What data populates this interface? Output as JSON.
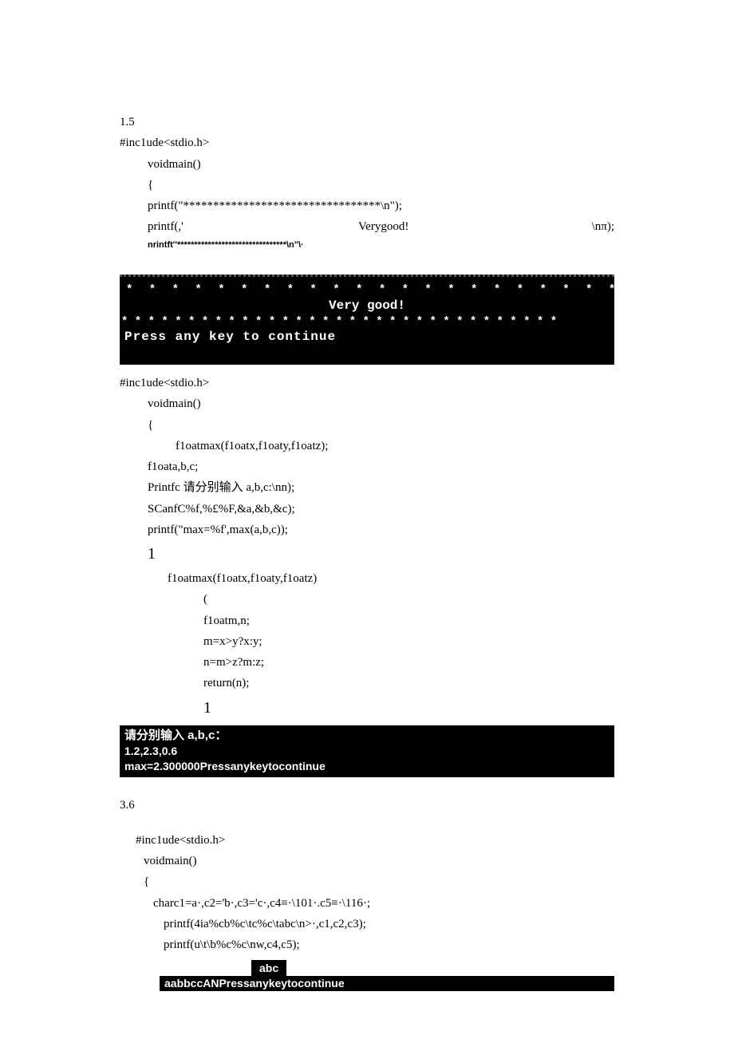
{
  "section1": {
    "heading": "1.5",
    "lines": {
      "l0": "#inc1ude<stdio.h>",
      "l1": "voidmain()",
      "l2": "{",
      "l3": "printf(\"*********************************\\n\");",
      "l4a": "printf(,'",
      "l4b": "Verygood!",
      "l4c": "\\nπ);",
      "l5": "nrintft''********************************\\n\"\\·"
    },
    "console": {
      "stars_top": "* * * * * * * * * * * * * * * * * * * * * * * * * * * * * * * * *",
      "vg": "Very good!",
      "stars_bot": "* * * * * * * * * * * * * * * * * * * * * * * * * * * * * * * * *",
      "press": "Press any key to continue"
    }
  },
  "section2": {
    "lines": {
      "l0": "#inc1ude<stdio.h>",
      "l1": "voidmain()",
      "l2": "{",
      "l3": "f1oatmax(f1oatx,f1oaty,f1oatz);",
      "l4": "f1oata,b,c;",
      "l5": "Printfc 请分别输入 a,b,c:\\nn);",
      "l6": "SCanfC%f,%£%F,&a,&b,&c);",
      "l7": "printf(\"max=%f',max(a,b,c));",
      "l8": "1",
      "l9": "f1oatmax(f1oatx,f1oaty,f1oatz)",
      "l10": "(",
      "l11": "f1oatm,n;",
      "l12": "m=x>y?x:y;",
      "l13": "n=m>z?m:z;",
      "l14": "return(n);",
      "l15": "1"
    },
    "console": {
      "r1": "请分别输入 a,b,c：",
      "r2": "1.2,2.3,0.6",
      "r3": "max=2.300000Pressanykeytocontinue"
    }
  },
  "section3": {
    "heading": "3.6",
    "lines": {
      "l0": "#inc1ude<stdio.h>",
      "l1": "voidmain()",
      "l2": "{",
      "l3": "charc1=a·,c2='b·,c3='c·,c4≡·\\101·.c5≡·\\116·;",
      "l4": "printf(4ia%cb%c\\tc%c\\tabc\\n>·,c1,c2,c3);",
      "l5": "printf(u\\t\\b%c%c\\nw,c4,c5);"
    },
    "console": {
      "abc": "abc",
      "line": "aabbccANPressanykeytocontinue"
    }
  }
}
